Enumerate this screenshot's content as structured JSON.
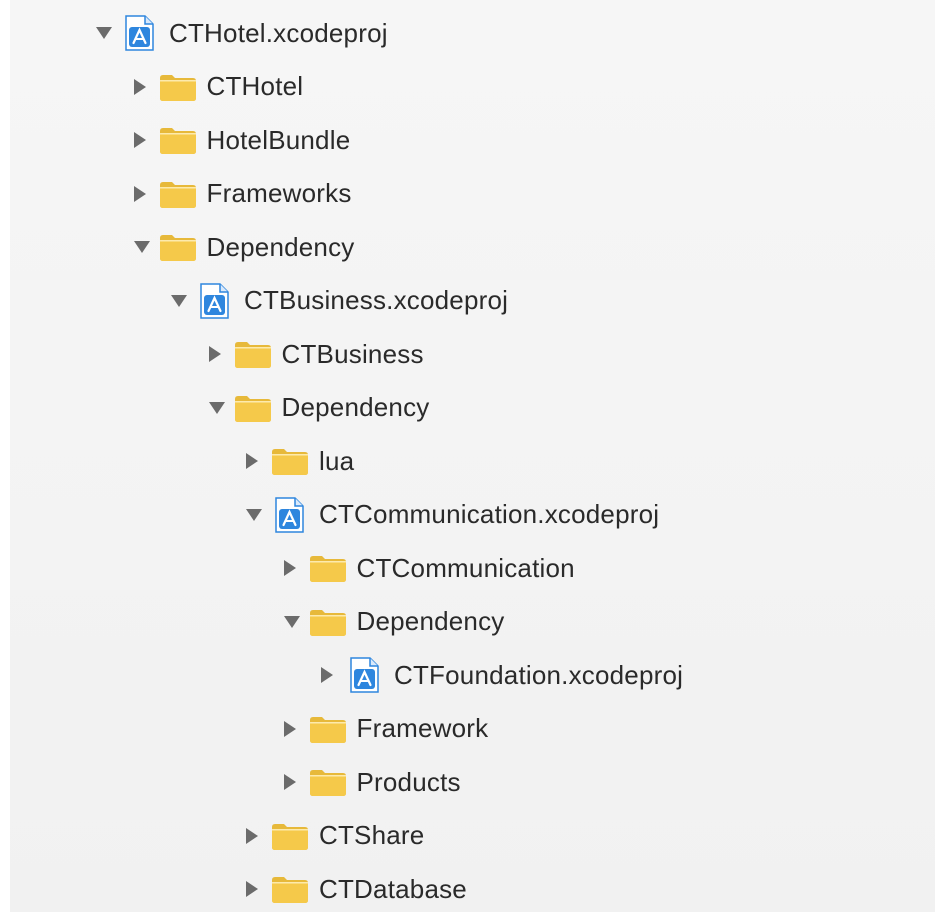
{
  "tree": [
    {
      "label": "CTHotel.xcodeproj",
      "depth": 0,
      "type": "xcodeproj",
      "expanded": true
    },
    {
      "label": "CTHotel",
      "depth": 1,
      "type": "folder",
      "expanded": false
    },
    {
      "label": "HotelBundle",
      "depth": 1,
      "type": "folder",
      "expanded": false
    },
    {
      "label": "Frameworks",
      "depth": 1,
      "type": "folder",
      "expanded": false
    },
    {
      "label": "Dependency",
      "depth": 1,
      "type": "folder",
      "expanded": true
    },
    {
      "label": "CTBusiness.xcodeproj",
      "depth": 2,
      "type": "xcodeproj",
      "expanded": true
    },
    {
      "label": "CTBusiness",
      "depth": 3,
      "type": "folder",
      "expanded": false
    },
    {
      "label": "Dependency",
      "depth": 3,
      "type": "folder",
      "expanded": true
    },
    {
      "label": "lua",
      "depth": 4,
      "type": "folder",
      "expanded": false
    },
    {
      "label": "CTCommunication.xcodeproj",
      "depth": 4,
      "type": "xcodeproj",
      "expanded": true
    },
    {
      "label": "CTCommunication",
      "depth": 5,
      "type": "folder",
      "expanded": false
    },
    {
      "label": "Dependency",
      "depth": 5,
      "type": "folder",
      "expanded": true
    },
    {
      "label": "CTFoundation.xcodeproj",
      "depth": 6,
      "type": "xcodeproj",
      "expanded": false
    },
    {
      "label": "Framework",
      "depth": 5,
      "type": "folder",
      "expanded": false
    },
    {
      "label": "Products",
      "depth": 5,
      "type": "folder",
      "expanded": false
    },
    {
      "label": "CTShare",
      "depth": 4,
      "type": "folder",
      "expanded": false
    },
    {
      "label": "CTDatabase",
      "depth": 4,
      "type": "folder",
      "expanded": false
    }
  ],
  "colors": {
    "triangle": "#6b6b6b",
    "folder_body": "#f5c94a",
    "folder_tab": "#e7b93a",
    "proj_blue": "#2e86de",
    "text": "#2a2a2a"
  }
}
